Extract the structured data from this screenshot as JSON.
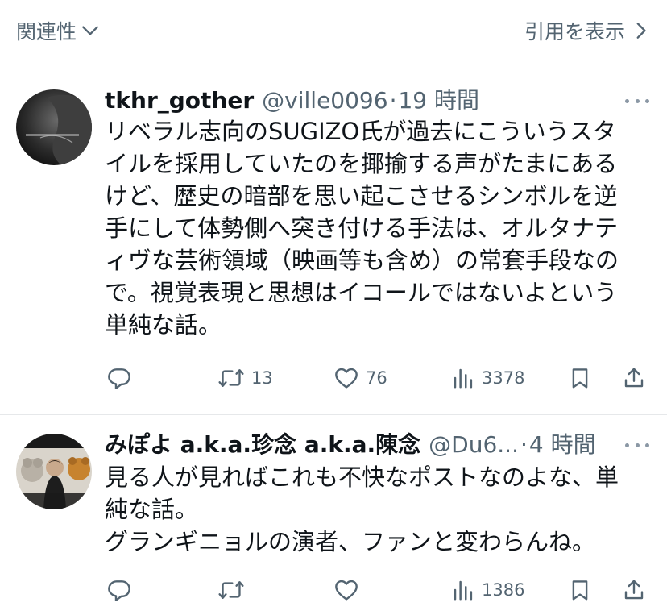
{
  "top_bar": {
    "sort_label": "関連性",
    "quotes_label": "引用を表示"
  },
  "posts": [
    {
      "display_name": "tkhr_gother",
      "handle": "@ville0096",
      "separator": "·",
      "time": "19 時間",
      "text": "リベラル志向のSUGIZO氏が過去にこういうスタ\nイルを採用していたのを揶揄する声がたまにある\nけど、歴史の暗部を思い起こさせるシンボルを逆\n手にして体勢側へ突き付ける手法は、オルタナテ\nィヴな芸術領域（映画等も含め）の常套手段なの\nで。視覚表現と思想はイコールではないよという\n単純な話。",
      "stats": {
        "replies": "",
        "reposts": "13",
        "likes": "76",
        "views": "3378"
      }
    },
    {
      "display_name": "みぽよ a.k.a.珍念 a.k.a.陳念",
      "handle": "@Du6...",
      "separator": "·",
      "time": "4 時間",
      "text": "見る人が見ればこれも不快なポストなのよな、単\n純な話。\nグランギニョルの演者、ファンと変わらんね。",
      "stats": {
        "replies": "",
        "reposts": "",
        "likes": "",
        "views": "1386"
      }
    }
  ],
  "icons": {
    "sort": "chevron-down-icon",
    "quotes": "chevron-right-icon",
    "more": "more-icon",
    "reply": "reply-icon",
    "repost": "repost-icon",
    "like": "heart-icon",
    "views": "views-icon",
    "bookmark": "bookmark-icon",
    "share": "share-icon"
  },
  "colors": {
    "text": "#0f1419",
    "secondary": "#536471",
    "divider": "#e6e8ea"
  }
}
